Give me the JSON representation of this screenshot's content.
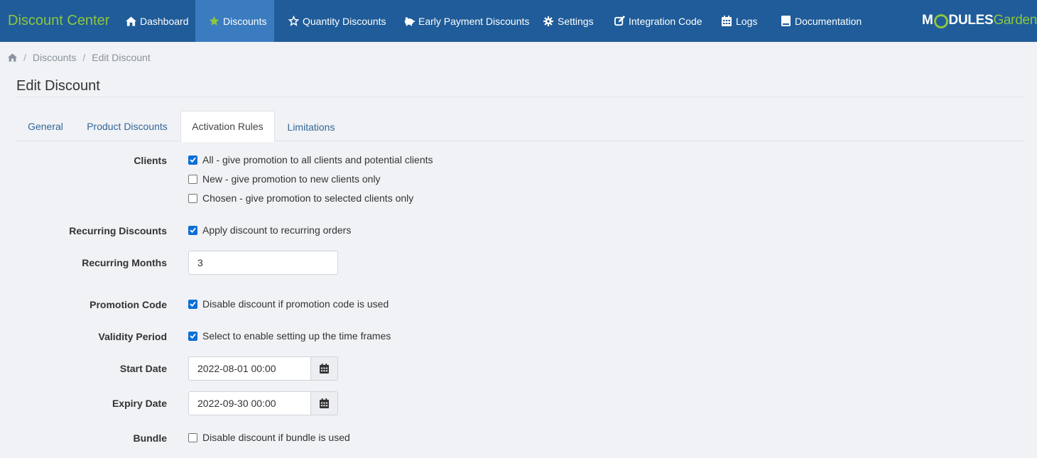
{
  "navbar": {
    "brand": "Discount Center",
    "items": [
      {
        "label": "Dashboard",
        "icon": "home-icon"
      },
      {
        "label": "Discounts",
        "icon": "star-icon",
        "active": true
      },
      {
        "label": "Quantity Discounts",
        "icon": "star-outline-icon"
      },
      {
        "label": "Early Payment Discounts",
        "icon": "piggy-bank-icon"
      },
      {
        "label": "Settings",
        "icon": "gear-icon"
      },
      {
        "label": "Integration Code",
        "icon": "edit-icon"
      },
      {
        "label": "Logs",
        "icon": "calendar-icon"
      },
      {
        "label": "Documentation",
        "icon": "book-icon"
      }
    ],
    "logo": {
      "part1": "M",
      "part2": "DULES",
      "part3": "Garden"
    }
  },
  "breadcrumb": {
    "items": [
      "Discounts",
      "Edit Discount"
    ],
    "separator": "/"
  },
  "page": {
    "title": "Edit Discount"
  },
  "tabs": [
    {
      "label": "General"
    },
    {
      "label": "Product Discounts"
    },
    {
      "label": "Activation Rules",
      "active": true
    },
    {
      "label": "Limitations"
    }
  ],
  "form": {
    "clients": {
      "label": "Clients",
      "options": [
        {
          "text": "All - give promotion to all clients and potential clients",
          "checked": true
        },
        {
          "text": "New - give promotion to new clients only",
          "checked": false
        },
        {
          "text": "Chosen - give promotion to selected clients only",
          "checked": false
        }
      ]
    },
    "recurring_discounts": {
      "label": "Recurring Discounts",
      "text": "Apply discount to recurring orders",
      "checked": true
    },
    "recurring_months": {
      "label": "Recurring Months",
      "value": "3"
    },
    "promotion_code": {
      "label": "Promotion Code",
      "text": "Disable discount if promotion code is used",
      "checked": true
    },
    "validity_period": {
      "label": "Validity Period",
      "text": "Select to enable setting up the time frames",
      "checked": true
    },
    "start_date": {
      "label": "Start Date",
      "value": "2022-08-01 00:00"
    },
    "expiry_date": {
      "label": "Expiry Date",
      "value": "2022-09-30 00:00"
    },
    "bundle": {
      "label": "Bundle",
      "text": "Disable discount if bundle is used",
      "checked": false
    }
  },
  "colors": {
    "navbar": "#1f5c99",
    "navbar_active": "#3b7cc0",
    "brand": "#8dc63f",
    "checkbox": "#0d6ed6",
    "link": "#336699"
  }
}
